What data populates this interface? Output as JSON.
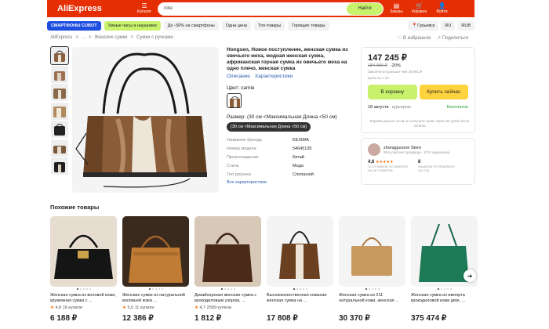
{
  "header": {
    "logo": "AliExpress",
    "catalog_label": "Каталог",
    "search_value": "nike",
    "search_button": "Найти",
    "icons": [
      {
        "name": "orders-icon",
        "label": "Заказы"
      },
      {
        "name": "cart-icon",
        "label": "Корзина"
      },
      {
        "name": "login-icon",
        "label": "Войти"
      }
    ]
  },
  "nav": {
    "pills": [
      "СМАРТФОНЫ CUBOT",
      "Умные часы и наушники",
      "До -50% на смартфоны",
      "Одна цена",
      "Топ-товары",
      "Горящие товары"
    ],
    "location": "Гурьевск",
    "lang": "RU",
    "currency": "RUB"
  },
  "breadcrumb": [
    "AliExpress",
    "...",
    "Женские сумки",
    "Сумки с ручками"
  ],
  "breadcrumb_separator": ">",
  "actions": {
    "favorite": "В избранное",
    "share": "Поделиться"
  },
  "product": {
    "title": "Hongsen, Новое поступление, женская сумка из овечьего меха, модная женская сумка, африканская горная сумка из овечьего меха на одно плечо, женская сумка",
    "links": [
      "Описание",
      "Характеристики"
    ],
    "color_label": "Цвет: camle",
    "size_label": "Размер: (30 см <Максимальная Длина <50 см)",
    "size_chip": "(30 см <Максимальная Длина <50 см)",
    "props": [
      {
        "k": "Название бренда",
        "v": "KEXIMA"
      },
      {
        "k": "Номер модели",
        "v": "54645135"
      },
      {
        "k": "Происхождение",
        "v": "Китай"
      },
      {
        "k": "Стиль",
        "v": "Мода"
      },
      {
        "k": "Тип рисунка",
        "v": "Сплошной"
      }
    ],
    "all_props": "Все характеристики"
  },
  "buy": {
    "price": "147 245 ₽",
    "old_price": "184 056 ₽",
    "discount": "-20%",
    "note1": "Закончится раньше чем 18 981 ₽",
    "note2": "Цена за 1 шт",
    "cart_button": "В корзину",
    "buy_button": "Купить сейчас",
    "delivery_date": "18 августа",
    "delivery_type": "курьером",
    "delivery_cost": "Бесплатно",
    "return_note": "Вернём деньги, если не получите заказ через 60 дней после оплаты"
  },
  "store": {
    "name": "zhongguoone Store",
    "sub": "90% рейтинг продавца · 572 подписчика",
    "rating": "4,6",
    "rating_stars": "★★★★★",
    "rating_desc": "10 ОТЗЫВОВ ОСТАВЛЕНО НА 2K ТОВАРОВ",
    "orders": "8",
    "orders_desc": "ЗАКАЗОВ ОТПРАВЛЕНО ЗА ГОД",
    "avatar_color": "#c9a9a0"
  },
  "similar_title": "Похожие товары",
  "cards": [
    {
      "title": "Женская сумка из воловой кожи, кружевная сумка с ...",
      "rating": "4,8",
      "count": "16 купили",
      "price": "6 188 ₽"
    },
    {
      "title": "Женские сумки из натуральной воловьей кожи ...",
      "rating": "5,0",
      "count": "11 купили",
      "price": "12 386 ₽"
    },
    {
      "title": "Дизайнерская женская сумка с крокодиловым узором, ...",
      "rating": "4,7",
      "count": "2589 купили",
      "price": "1 812 ₽"
    },
    {
      "title": "Высококачественная кожаная женская сумка на ...",
      "rating": "",
      "count": "",
      "price": "17 808 ₽"
    },
    {
      "title": "Женская сумка из 211 натуральной кожи, женская ...",
      "rating": "",
      "count": "",
      "price": "30 370 ₽"
    },
    {
      "title": "Женская сумка из импорта крокодиловой кожи gete, ...",
      "rating": "",
      "count": "",
      "price": "375 474 ₽"
    }
  ],
  "colors": {
    "brand": "#e62e04",
    "green": "#c8f26c",
    "yellow": "#ffd33d",
    "blue": "#1e4ee0"
  }
}
